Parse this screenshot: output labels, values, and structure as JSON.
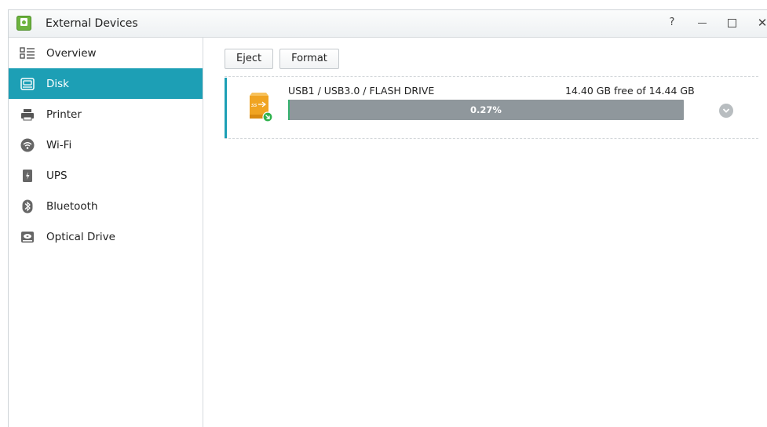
{
  "window": {
    "title": "External Devices",
    "help_glyph": "?",
    "close_glyph": "✕"
  },
  "sidebar": {
    "items": [
      {
        "label": "Overview",
        "icon": "overview-icon",
        "active": false
      },
      {
        "label": "Disk",
        "icon": "disk-icon",
        "active": true
      },
      {
        "label": "Printer",
        "icon": "printer-icon",
        "active": false
      },
      {
        "label": "Wi-Fi",
        "icon": "wifi-icon",
        "active": false
      },
      {
        "label": "UPS",
        "icon": "ups-icon",
        "active": false
      },
      {
        "label": "Bluetooth",
        "icon": "bluetooth-icon",
        "active": false
      },
      {
        "label": "Optical Drive",
        "icon": "optical-drive-icon",
        "active": false
      }
    ]
  },
  "toolbar": {
    "eject_label": "Eject",
    "format_label": "Format"
  },
  "device": {
    "name": "USB1 / USB3.0 / FLASH DRIVE",
    "space": "14.40 GB free of 14.44 GB",
    "usage_label": "0.27%",
    "usage_fraction": 0.0027,
    "icon": "usb-drive-icon"
  },
  "colors": {
    "accent": "#1d9fb5",
    "progress_bg": "#8f979c",
    "progress_fill": "#36b26f",
    "usb_orange": "#f0a422"
  }
}
